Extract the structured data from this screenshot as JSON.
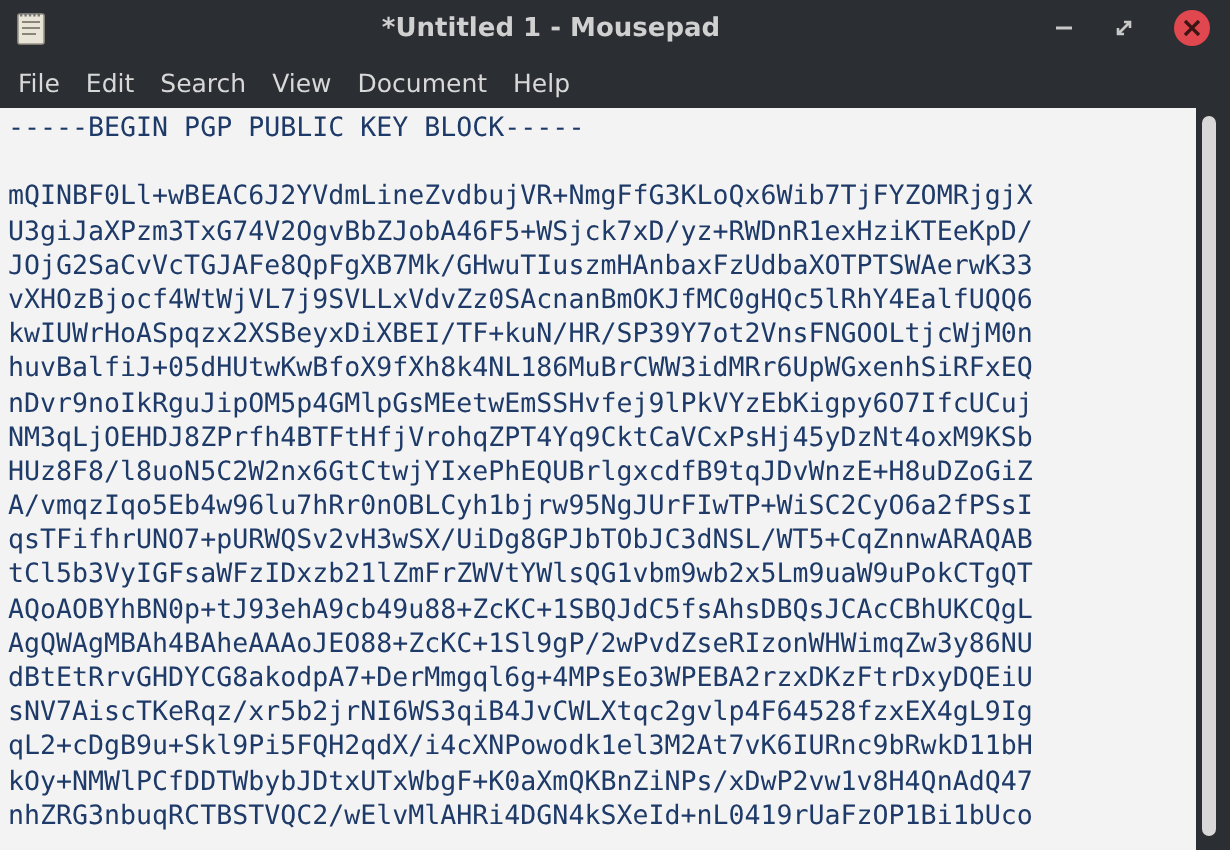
{
  "window": {
    "title": "*Untitled 1 - Mousepad"
  },
  "menu": [
    "File",
    "Edit",
    "Search",
    "View",
    "Document",
    "Help"
  ],
  "editor": {
    "header": "-----BEGIN PGP PUBLIC KEY BLOCK-----",
    "lines": [
      "mQINBF0Ll+wBEAC6J2YVdmLineZvdbujVR+NmgFfG3KLoQx6Wib7TjFYZOMRjgjX",
      "U3giJaXPzm3TxG74V2OgvBbZJobA46F5+WSjck7xD/yz+RWDnR1exHziKTEeKpD/",
      "JOjG2SaCvVcTGJAFe8QpFgXB7Mk/GHwuTIuszmHAnbaxFzUdbaXOTPTSWAerwK33",
      "vXHOzBjocf4WtWjVL7j9SVLLxVdvZz0SAcnanBmOKJfMC0gHQc5lRhY4EalfUQQ6",
      "kwIUWrHoASpqzx2XSBeyxDiXBEI/TF+kuN/HR/SP39Y7ot2VnsFNGOOLtjcWjM0n",
      "huvBalfiJ+05dHUtwKwBfoX9fXh8k4NL186MuBrCWW3idMRr6UpWGxenhSiRFxEQ",
      "nDvr9noIkRguJipOM5p4GMlpGsMEetwEmSSHvfej9lPkVYzEbKigpy6O7IfcUCuj",
      "NM3qLjOEHDJ8ZPrfh4BTFtHfjVrohqZPT4Yq9CktCaVCxPsHj45yDzNt4oxM9KSb",
      "HUz8F8/l8uoN5C2W2nx6GtCtwjYIxePhEQUBrlgxcdfB9tqJDvWnzE+H8uDZoGiZ",
      "A/vmqzIqo5Eb4w96lu7hRr0nOBLCyh1bjrw95NgJUrFIwTP+WiSC2CyO6a2fPSsI",
      "qsTFifhrUNO7+pURWQSv2vH3wSX/UiDg8GPJbTObJC3dNSL/WT5+CqZnnwARAQAB",
      "tCl5b3VyIGFsaWFzIDxzb21lZmFrZWVtYWlsQG1vbm9wb2x5Lm9uaW9uPokCTgQT",
      "AQoAOBYhBN0p+tJ93ehA9cb49u88+ZcKC+1SBQJdC5fsAhsDBQsJCAcCBhUKCQgL",
      "AgQWAgMBAh4BAheAAAoJEO88+ZcKC+1Sl9gP/2wPvdZseRIzonWHWimqZw3y86NU",
      "dBtEtRrvGHDYCG8akodpA7+DerMmgql6g+4MPsEo3WPEBA2rzxDKzFtrDxyDQEiU",
      "sNV7AiscTKeRqz/xr5b2jrNI6WS3qiB4JvCWLXtqc2gvlp4F64528fzxEX4gL9Ig",
      "qL2+cDgB9u+Skl9Pi5FQH2qdX/i4cXNPowodk1el3M2At7vK6IURnc9bRwkD11bH",
      "kOy+NMWlPCfDDTWbybJDtxUTxWbgF+K0aXmQKBnZiNPs/xDwP2vw1v8H4QnAdQ47",
      "nhZRG3nbuqRCTBSTVQC2/wElvMlAHRi4DGN4kSXeId+nL0419rUaFzOP1Bi1bUco"
    ]
  }
}
